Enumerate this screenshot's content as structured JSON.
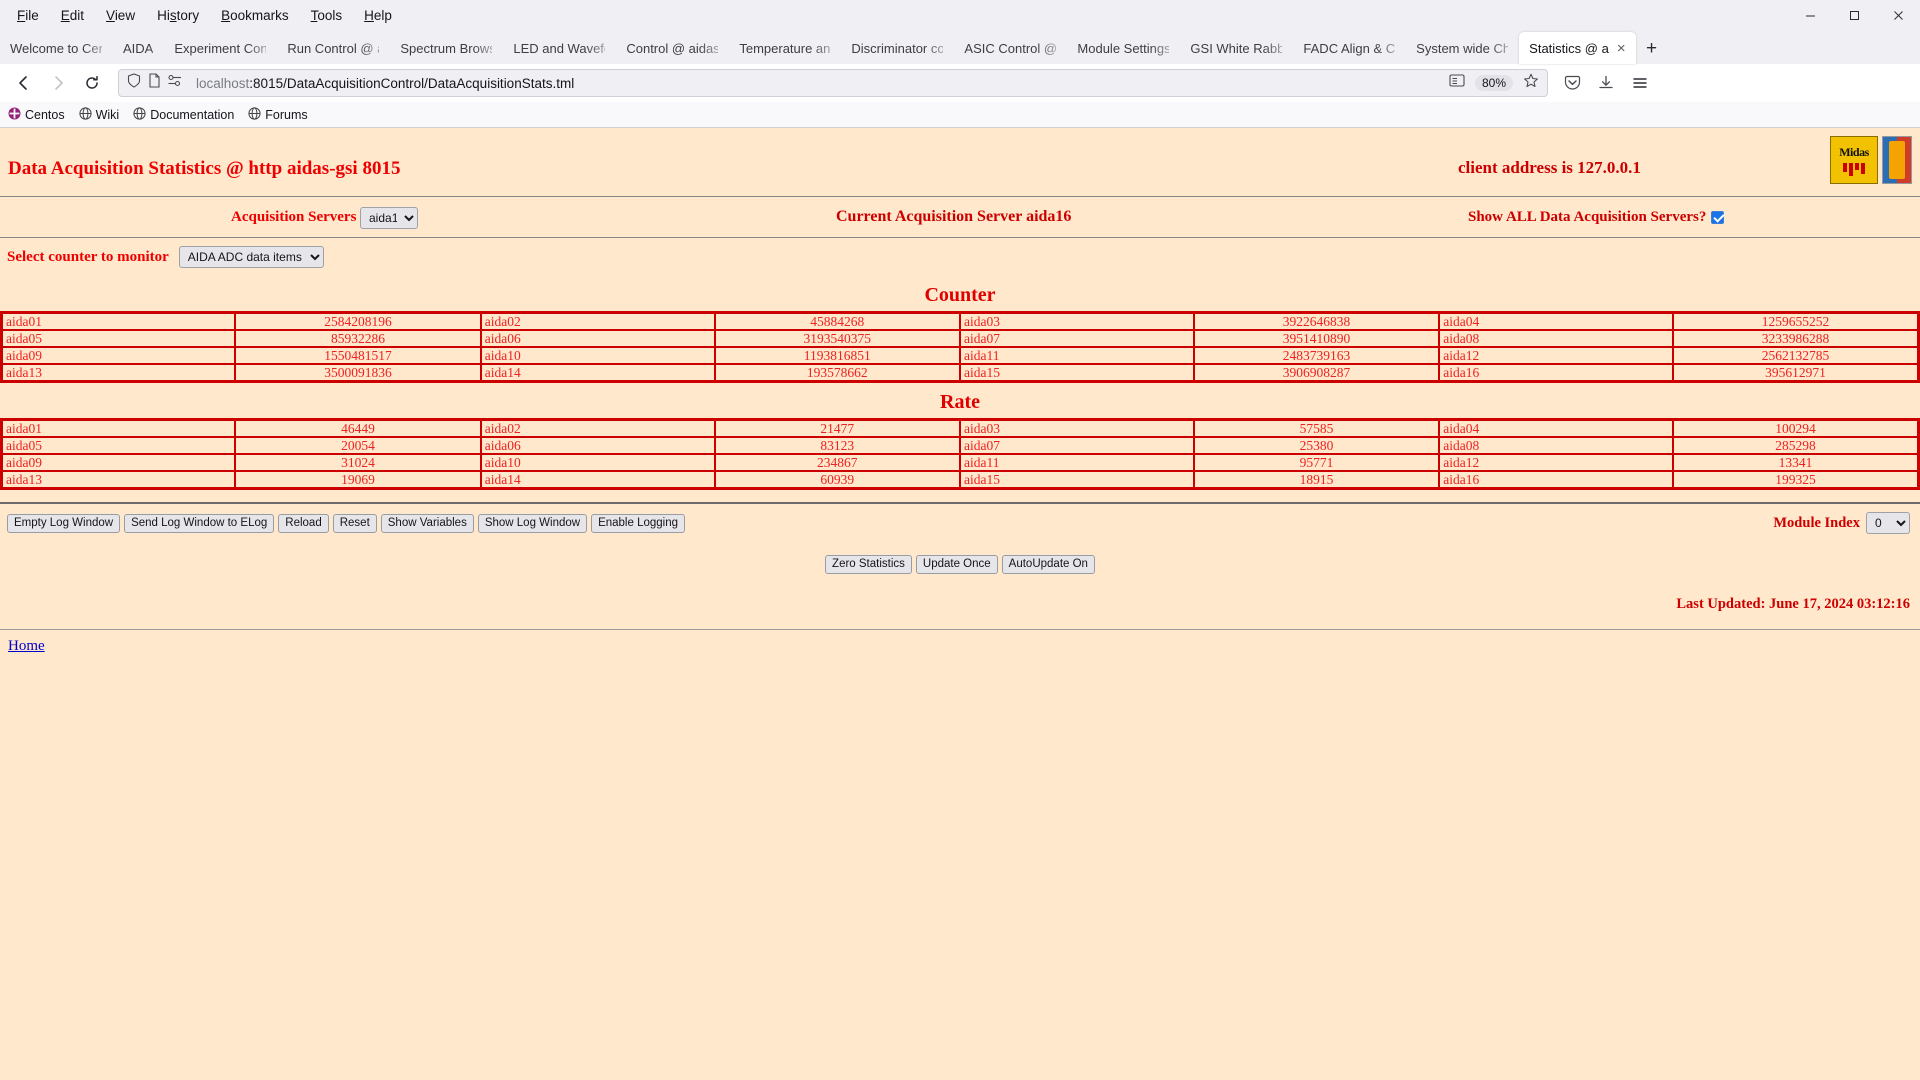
{
  "browser": {
    "menus": [
      "File",
      "Edit",
      "View",
      "History",
      "Bookmarks",
      "Tools",
      "Help"
    ],
    "window_controls": {
      "minimize": "minimize-icon",
      "maximize": "maximize-icon",
      "close": "close-icon"
    },
    "tabs": [
      {
        "label": "Welcome to Cen",
        "active": false
      },
      {
        "label": "AIDA",
        "active": false
      },
      {
        "label": "Experiment Cont",
        "active": false
      },
      {
        "label": "Run Control @ a",
        "active": false
      },
      {
        "label": "Spectrum Brows",
        "active": false
      },
      {
        "label": "LED and Wavefo",
        "active": false
      },
      {
        "label": "Control @ aidas",
        "active": false
      },
      {
        "label": "Temperature an",
        "active": false
      },
      {
        "label": "Discriminator co",
        "active": false
      },
      {
        "label": "ASIC Control @",
        "active": false
      },
      {
        "label": "Module Settings",
        "active": false
      },
      {
        "label": "GSI White Rabb",
        "active": false
      },
      {
        "label": "FADC Align & C",
        "active": false
      },
      {
        "label": "System wide Ch",
        "active": false
      },
      {
        "label": "Statistics @ a",
        "active": true
      }
    ],
    "new_tab_label": "+",
    "nav": {
      "back": "back-arrow-icon",
      "forward": "forward-arrow-icon",
      "reload": "reload-icon"
    },
    "url": {
      "host": "localhost",
      "rest": ":8015/DataAcquisitionControl/DataAcquisitionStats.tml",
      "full": "localhost:8015/DataAcquisitionControl/DataAcquisitionStats.tml"
    },
    "zoom_level": "80%",
    "bookmarks": [
      {
        "label": "Centos",
        "icon": "centos-icon"
      },
      {
        "label": "Wiki",
        "icon": "globe-icon"
      },
      {
        "label": "Documentation",
        "icon": "globe-icon"
      },
      {
        "label": "Forums",
        "icon": "globe-icon"
      }
    ]
  },
  "page": {
    "title": "Data Acquisition Statistics @ http aidas-gsi 8015",
    "client_address": "client address is 127.0.0.1",
    "acquisition_servers_label": "Acquisition Servers",
    "acquisition_server_value": "aida16",
    "current_server": "Current Acquisition Server aida16",
    "show_all_label": "Show ALL Data Acquisition Servers?",
    "show_all_checked": true,
    "select_counter_label": "Select counter to monitor",
    "counter_select_value": "AIDA ADC data items",
    "counter_title": "Counter",
    "rate_title": "Rate",
    "module_index_label": "Module Index",
    "module_index_value": "0",
    "last_updated": "Last Updated: June 17, 2024 03:12:16",
    "home_link": "Home",
    "buttons_left": [
      "Empty Log Window",
      "Send Log Window to ELog",
      "Reload",
      "Reset",
      "Show Variables",
      "Show Log Window",
      "Enable Logging"
    ],
    "buttons_center": [
      "Zero Statistics",
      "Update Once",
      "AutoUpdate On"
    ],
    "counter_rows": [
      [
        [
          "aida01",
          "2584208196"
        ],
        [
          "aida02",
          "45884268"
        ],
        [
          "aida03",
          "3922646838"
        ],
        [
          "aida04",
          "1259655252"
        ]
      ],
      [
        [
          "aida05",
          "85932286"
        ],
        [
          "aida06",
          "3193540375"
        ],
        [
          "aida07",
          "3951410890"
        ],
        [
          "aida08",
          "3233986288"
        ]
      ],
      [
        [
          "aida09",
          "1550481517"
        ],
        [
          "aida10",
          "1193816851"
        ],
        [
          "aida11",
          "2483739163"
        ],
        [
          "aida12",
          "2562132785"
        ]
      ],
      [
        [
          "aida13",
          "3500091836"
        ],
        [
          "aida14",
          "193578662"
        ],
        [
          "aida15",
          "3906908287"
        ],
        [
          "aida16",
          "395612971"
        ]
      ]
    ],
    "rate_rows": [
      [
        [
          "aida01",
          "46449"
        ],
        [
          "aida02",
          "21477"
        ],
        [
          "aida03",
          "57585"
        ],
        [
          "aida04",
          "100294"
        ]
      ],
      [
        [
          "aida05",
          "20054"
        ],
        [
          "aida06",
          "83123"
        ],
        [
          "aida07",
          "25380"
        ],
        [
          "aida08",
          "285298"
        ]
      ],
      [
        [
          "aida09",
          "31024"
        ],
        [
          "aida10",
          "234867"
        ],
        [
          "aida11",
          "95771"
        ],
        [
          "aida12",
          "13341"
        ]
      ],
      [
        [
          "aida13",
          "19069"
        ],
        [
          "aida14",
          "60939"
        ],
        [
          "aida15",
          "18915"
        ],
        [
          "aida16",
          "199325"
        ]
      ]
    ],
    "colors": {
      "background": "#ffe8cc",
      "heading_red": "#ee0000",
      "table_border": "#cc0000",
      "link_blue": "#0000cc"
    }
  }
}
